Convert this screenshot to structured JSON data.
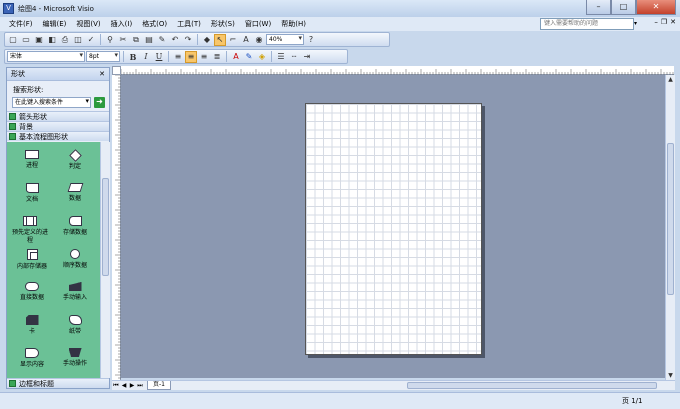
{
  "window": {
    "title": "绘图4 - Microsoft Visio"
  },
  "menu": [
    "文件(F)",
    "编辑(E)",
    "视图(V)",
    "插入(I)",
    "格式(O)",
    "工具(T)",
    "形状(S)",
    "窗口(W)",
    "帮助(H)"
  ],
  "help_search": {
    "placeholder": "键入需要帮助的问题"
  },
  "toolbar": {
    "zoom": "40%"
  },
  "format": {
    "font": "宋体",
    "size": "8pt",
    "bold": "B",
    "italic": "I",
    "underline": "U"
  },
  "shapes_panel": {
    "title": "形状",
    "search_label": "搜索形状:",
    "search_placeholder": "在此键入搜索条件",
    "stencils_top": [
      "箭头形状",
      "背景",
      "基本流程图形状"
    ],
    "shapes": [
      "进程",
      "判定",
      "文档",
      "数据",
      "预先定义的进程",
      "存储数据",
      "内部存储器",
      "顺序数据",
      "直接数据",
      "手动输入",
      "卡",
      "纸带",
      "显示内容",
      "手动操作"
    ],
    "stencils_bottom": [
      "边框和标题"
    ]
  },
  "page_tab": "页-1",
  "status": {
    "page": "页 1/1"
  }
}
